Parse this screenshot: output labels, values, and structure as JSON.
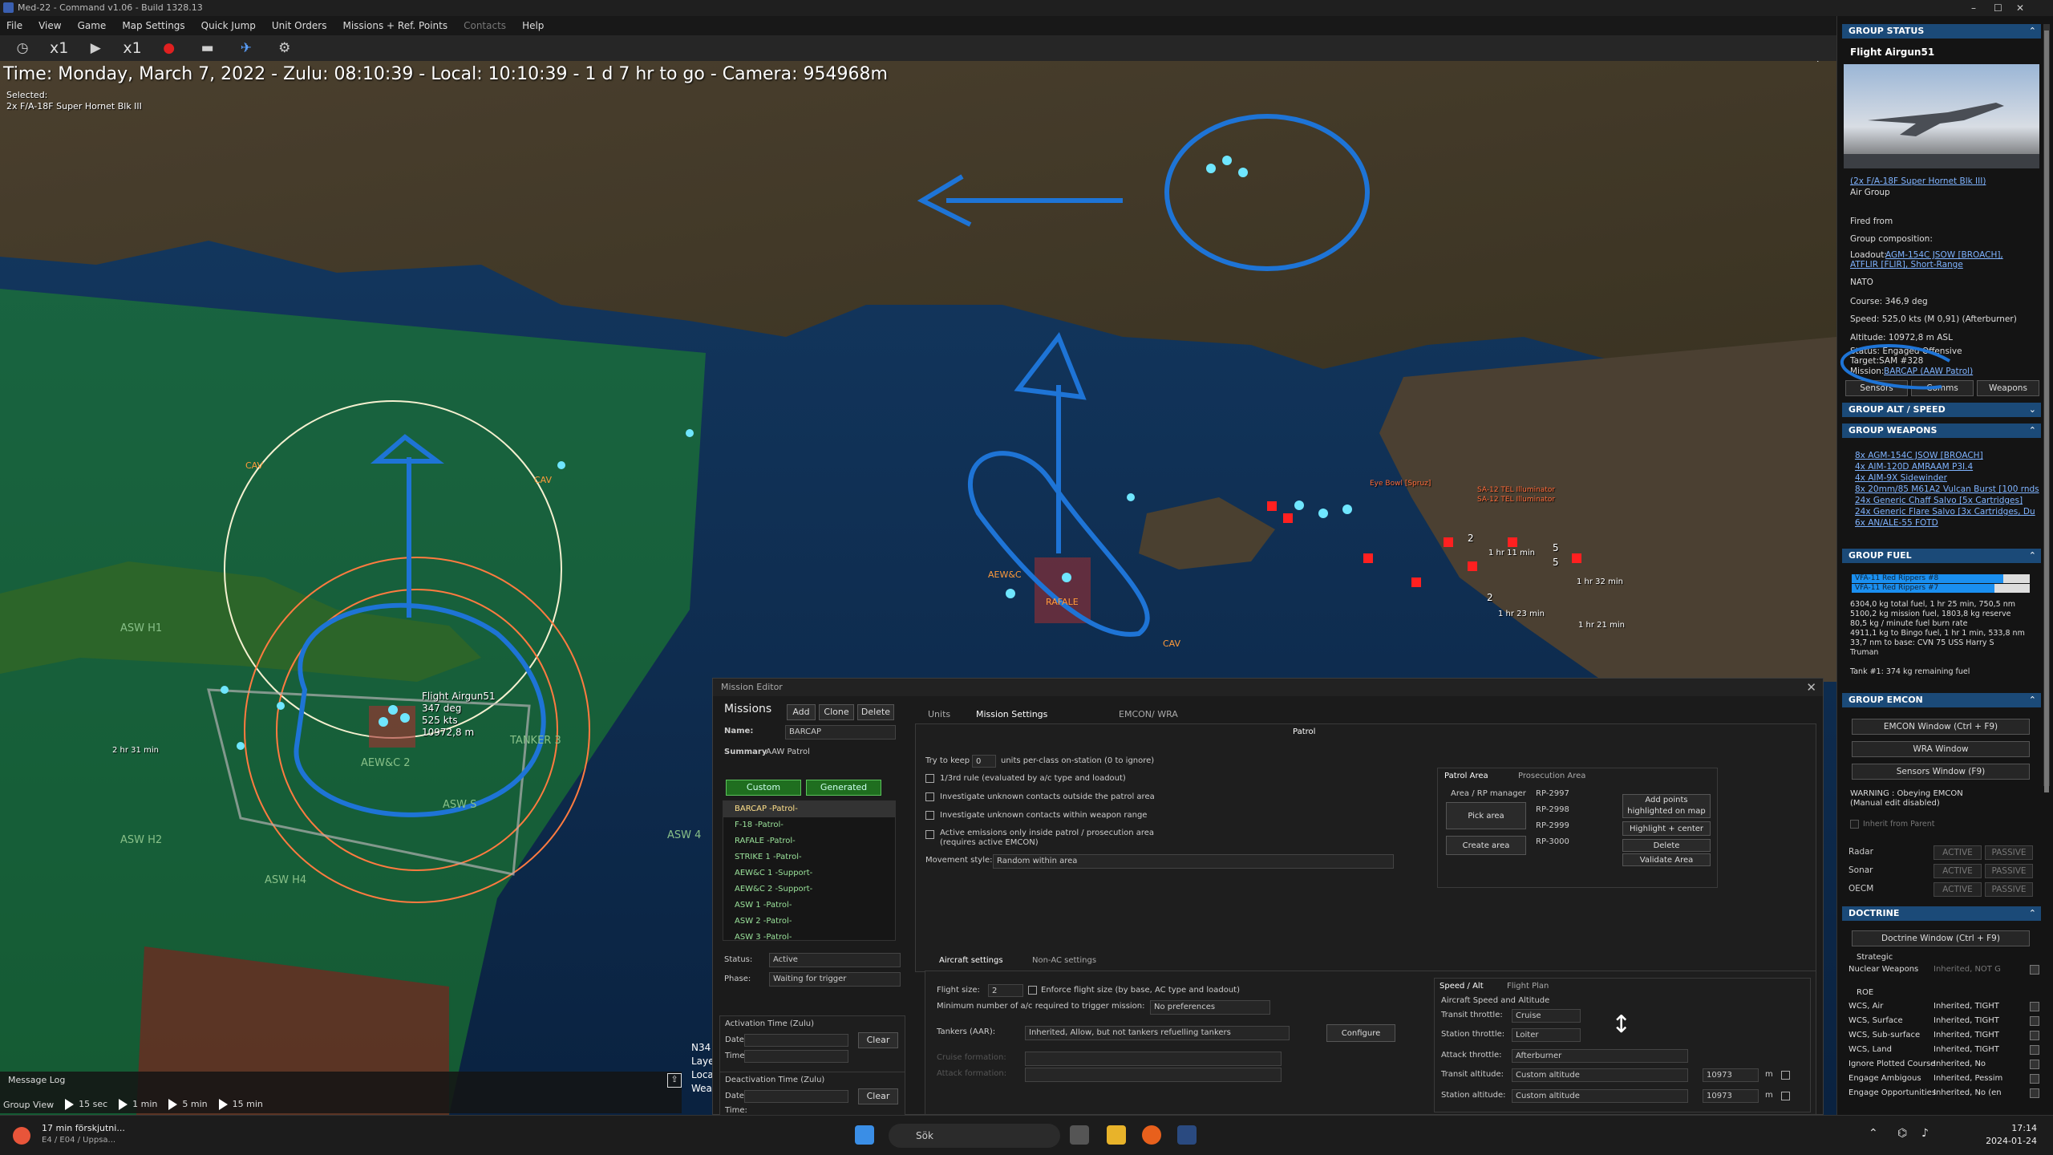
{
  "window": {
    "title": "Med-22 - Command v1.06 - Build 1328.13",
    "controls": [
      "–",
      "☐",
      "✕"
    ]
  },
  "menu": [
    {
      "label": "File",
      "enabled": true
    },
    {
      "label": "View",
      "enabled": true
    },
    {
      "label": "Game",
      "enabled": true
    },
    {
      "label": "Map Settings",
      "enabled": true
    },
    {
      "label": "Quick Jump",
      "enabled": true
    },
    {
      "label": "Unit Orders",
      "enabled": true
    },
    {
      "label": "Missions + Ref. Points",
      "enabled": true
    },
    {
      "label": "Contacts",
      "enabled": false
    },
    {
      "label": "Help",
      "enabled": true
    }
  ],
  "toolbar": {
    "speed1": "x1",
    "speed2": "x1"
  },
  "hud": {
    "time": "Time: Monday, March 7, 2022 - Zulu: 08:10:39 - Local: 10:10:39 - 1 d 7 hr to go -  Camera: 954968m",
    "selected_label": "Selected:",
    "selected_unit": "2x F/A-18F Super Hornet Blk III"
  },
  "map": {
    "flight": {
      "name": "Flight Airgun51",
      "course": "347 deg",
      "speed": "525 kts",
      "alt": "10972,8 m"
    },
    "labels": {
      "aewc2": "AEW&C 2",
      "tanker": "TANKER 3",
      "asw1": "ASW H1",
      "asw2": "ASW H2",
      "asw4": "ASW H4",
      "asw": "ASW 4",
      "asw_s": "ASW S",
      "cav1": "CAV",
      "cav2": "CAV",
      "cav3": "CAV",
      "rafale": "RAFALE",
      "akrotiri": "AEW&C",
      "time_a": "2 hr 31 min",
      "time_b": "1 hr 11 min",
      "time_c": "1 hr 32 min",
      "time_d": "1 hr 23 min",
      "time_e": "1 hr 21 min",
      "five1": "5",
      "five2": "5",
      "two1": "2",
      "two2": "2",
      "threat1": "Eye Bowl [Spruz]",
      "threat2": "SA-12 TEL Illuminator",
      "threat3": "SA-12 TEL Illuminator"
    }
  },
  "msglog": {
    "title": "Message Log",
    "group_view": "Group View",
    "steps": [
      "15 sec",
      "1 min",
      "5 min",
      "15 min"
    ]
  },
  "latlon": {
    "l1": "N34",
    "l2": "Laye",
    "l3": "Loca",
    "l4": "Wea"
  },
  "mission_editor": {
    "title": "Mission Editor",
    "missions_label": "Missions",
    "buttons": {
      "add": "Add",
      "clone": "Clone",
      "delete": "Delete"
    },
    "name_label": "Name:",
    "name_value": "BARCAP",
    "summary_label": "Summary",
    "summary_value": "AAW Patrol",
    "filters": {
      "custom": "Custom",
      "generated": "Generated"
    },
    "list": [
      "BARCAP -Patrol-",
      "F-18 -Patrol-",
      "RAFALE -Patrol-",
      "STRIKE 1 -Patrol-",
      "AEW&C 1 -Support-",
      "AEW&C 2 -Support-",
      "ASW 1 -Patrol-",
      "ASW 2 -Patrol-",
      "ASW 3 -Patrol-"
    ],
    "status_label": "Status:",
    "status_value": "Active",
    "phase_label": "Phase:",
    "phase_value": "Waiting for trigger",
    "activation": {
      "title": "Activation Time (Zulu)",
      "date": "Date:",
      "time": "Time:",
      "clear": "Clear"
    },
    "deactivation": {
      "title": "Deactivation Time (Zulu)",
      "date": "Date:",
      "time": "Time:",
      "clear": "Clear"
    },
    "tabs": {
      "units": "Units",
      "settings": "Mission Settings",
      "emcon": "EMCON/ WRA",
      "patrol": "Patrol"
    },
    "settings": {
      "try_keep_a": "Try to keep",
      "try_keep_value": "0",
      "try_keep_b": "units per-class on-station (0 to ignore)",
      "rule": "1/3rd rule (evaluated by a/c type and loadout)",
      "inv_out": "Investigate unknown contacts outside the patrol area",
      "inv_in": "Investigate unknown contacts within weapon range",
      "active_em": "Active emissions only inside patrol / prosecution area",
      "active_em2": "(requires active EMCON)",
      "movement_label": "Movement style:",
      "movement_value": "Random within area"
    },
    "areas": {
      "patrol_tab": "Patrol Area",
      "prosecution_tab": "Prosecution Area",
      "group_label": "Area / RP manager",
      "pick": "Pick area",
      "create": "Create area",
      "rps": [
        "RP-2997",
        "RP-2998",
        "RP-2999",
        "RP-3000"
      ],
      "add_points": "Add points highlighted on map",
      "highlight": "Highlight + center",
      "delete": "Delete",
      "validate": "Validate Area"
    },
    "aircraft_tabs": {
      "ac": "Aircraft settings",
      "nonac": "Non-AC settings"
    },
    "aircraft": {
      "flight_size_label": "Flight size:",
      "flight_size_value": "2",
      "enforce": "Enforce flight size (by base, AC type and loadout)",
      "min_label": "Minimum number of a/c required to trigger mission:",
      "min_value": "No preferences",
      "tankers_label": "Tankers (AAR):",
      "tankers_value": "Inherited, Allow, but not tankers refuelling tankers",
      "configure": "Configure",
      "cruise_label": "Cruise formation:",
      "attack_label": "Attack formation:"
    },
    "speed_alt": {
      "tab1": "Speed / Alt",
      "tab2": "Flight Plan",
      "group": "Aircraft Speed and Altitude",
      "transit_label": "Transit throttle:",
      "transit_value": "Cruise",
      "station_label": "Station throttle:",
      "station_value": "Loiter",
      "attack_label": "Attack throttle:",
      "attack_value": "Afterburner",
      "talt_label": "Transit altitude:",
      "talt_value": "Custom altitude",
      "talt_num": "10973",
      "salt_label": "Station altitude:",
      "salt_value": "Custom altitude",
      "salt_num": "10973",
      "unit": "m"
    }
  },
  "right_panel": {
    "group_status": "GROUP STATUS",
    "flight_name": "Flight Airgun51",
    "unit_link": "(2x F/A-18F Super Hornet Blk III)",
    "unit_type": "Air Group",
    "fired_from": "Fired from",
    "composition": "Group composition:",
    "loadout_label": "Loadout:",
    "loadout_value": "AGM-154C JSOW [BROACH],",
    "loadout_value2": "ATFLIR [FLIR], Short-Range",
    "side": "NATO",
    "course": "Course: 346,9 deg",
    "speed": "Speed: 525,0 kts (M 0,91) (Afterburner)",
    "altitude": "Altitude: 10972,8 m ASL",
    "status": "Status: Engaged Offensive",
    "target": "Target:SAM #328",
    "mission_label": "Mission:",
    "mission_value": "BARCAP (AAW Patrol)",
    "btns": {
      "sensors": "Sensors",
      "comms": "Comms",
      "weapons": "Weapons"
    },
    "alt_speed": "GROUP ALT / SPEED",
    "weapons_title": "GROUP WEAPONS",
    "weapons": [
      "8x AGM-154C JSOW [BROACH]",
      "4x AIM-120D AMRAAM P3I.4",
      "4x AIM-9X Sidewinder",
      "8x 20mm/85 M61A2 Vulcan Burst [100 rnds",
      "24x Generic Chaff Salvo [5x Cartridges]",
      "24x Generic Flare Salvo [3x Cartridges, Du",
      "6x AN/ALE-55 FOTD"
    ],
    "fuel_title": "GROUP FUEL",
    "fuel_bars": [
      {
        "name": "VFA-11 Red Rippers #8",
        "level": 0.85
      },
      {
        "name": "VFA-11 Red Rippers #7",
        "level": 0.8
      }
    ],
    "fuel_lines": [
      "6304,0 kg total fuel, 1 hr 25 min, 750,5 nm",
      "5100,2 kg mission fuel, 1803,8 kg reserve",
      "80,5 kg / minute fuel burn rate",
      "4911,1 kg to Bingo fuel, 1 hr 1 min, 533,8 nm",
      "33,7 nm to base: CVN 75 USS Harry S",
      "Truman"
    ],
    "tank": "Tank #1: 374 kg remaining fuel",
    "emcon_title": "GROUP EMCON",
    "emcon_window": "EMCON Window (Ctrl + F9)",
    "wra_window": "WRA Window",
    "sensors_window": "Sensors Window (F9)",
    "warning": "WARNING : Obeying EMCON",
    "warning2": "(Manual edit disabled)",
    "inherit": "Inherit from Parent",
    "emcon_rows": [
      {
        "label": "Radar",
        "a": "ACTIVE",
        "p": "PASSIVE"
      },
      {
        "label": "Sonar",
        "a": "ACTIVE",
        "p": "PASSIVE"
      },
      {
        "label": "OECM",
        "a": "ACTIVE",
        "p": "PASSIVE"
      }
    ],
    "doctrine_title": "DOCTRINE",
    "doctrine_window": "Doctrine Window (Ctrl + F9)",
    "strategic": "Strategic",
    "nuclear_label": "Nuclear Weapons",
    "nuclear_value": "Inherited, NOT G",
    "roe": "ROE",
    "roe_rows": [
      {
        "k": "WCS, Air",
        "v": "Inherited, TIGHT"
      },
      {
        "k": "WCS, Surface",
        "v": "Inherited, TIGHT"
      },
      {
        "k": "WCS, Sub-surface",
        "v": "Inherited, TIGHT"
      },
      {
        "k": "WCS, Land",
        "v": "Inherited, TIGHT"
      },
      {
        "k": "Ignore Plotted Course",
        "v": "Inherited, No"
      },
      {
        "k": "Engage Ambigous",
        "v": "Inherited, Pessim"
      },
      {
        "k": "Engage Opportunities",
        "v": "Inherited, No (en"
      }
    ]
  },
  "taskbar": {
    "notif1": "17 min förskjutni...",
    "notif2": "E4 / E04 / Uppsa...",
    "search": "Sök",
    "time": "17:14",
    "date": "2024-01-24"
  },
  "colors": {
    "accent": "#1b4a78",
    "annotation": "#1e74d6",
    "green_zone": "#1f8a2a",
    "friendly": "#6fe6ff",
    "hostile": "#ff2020"
  }
}
